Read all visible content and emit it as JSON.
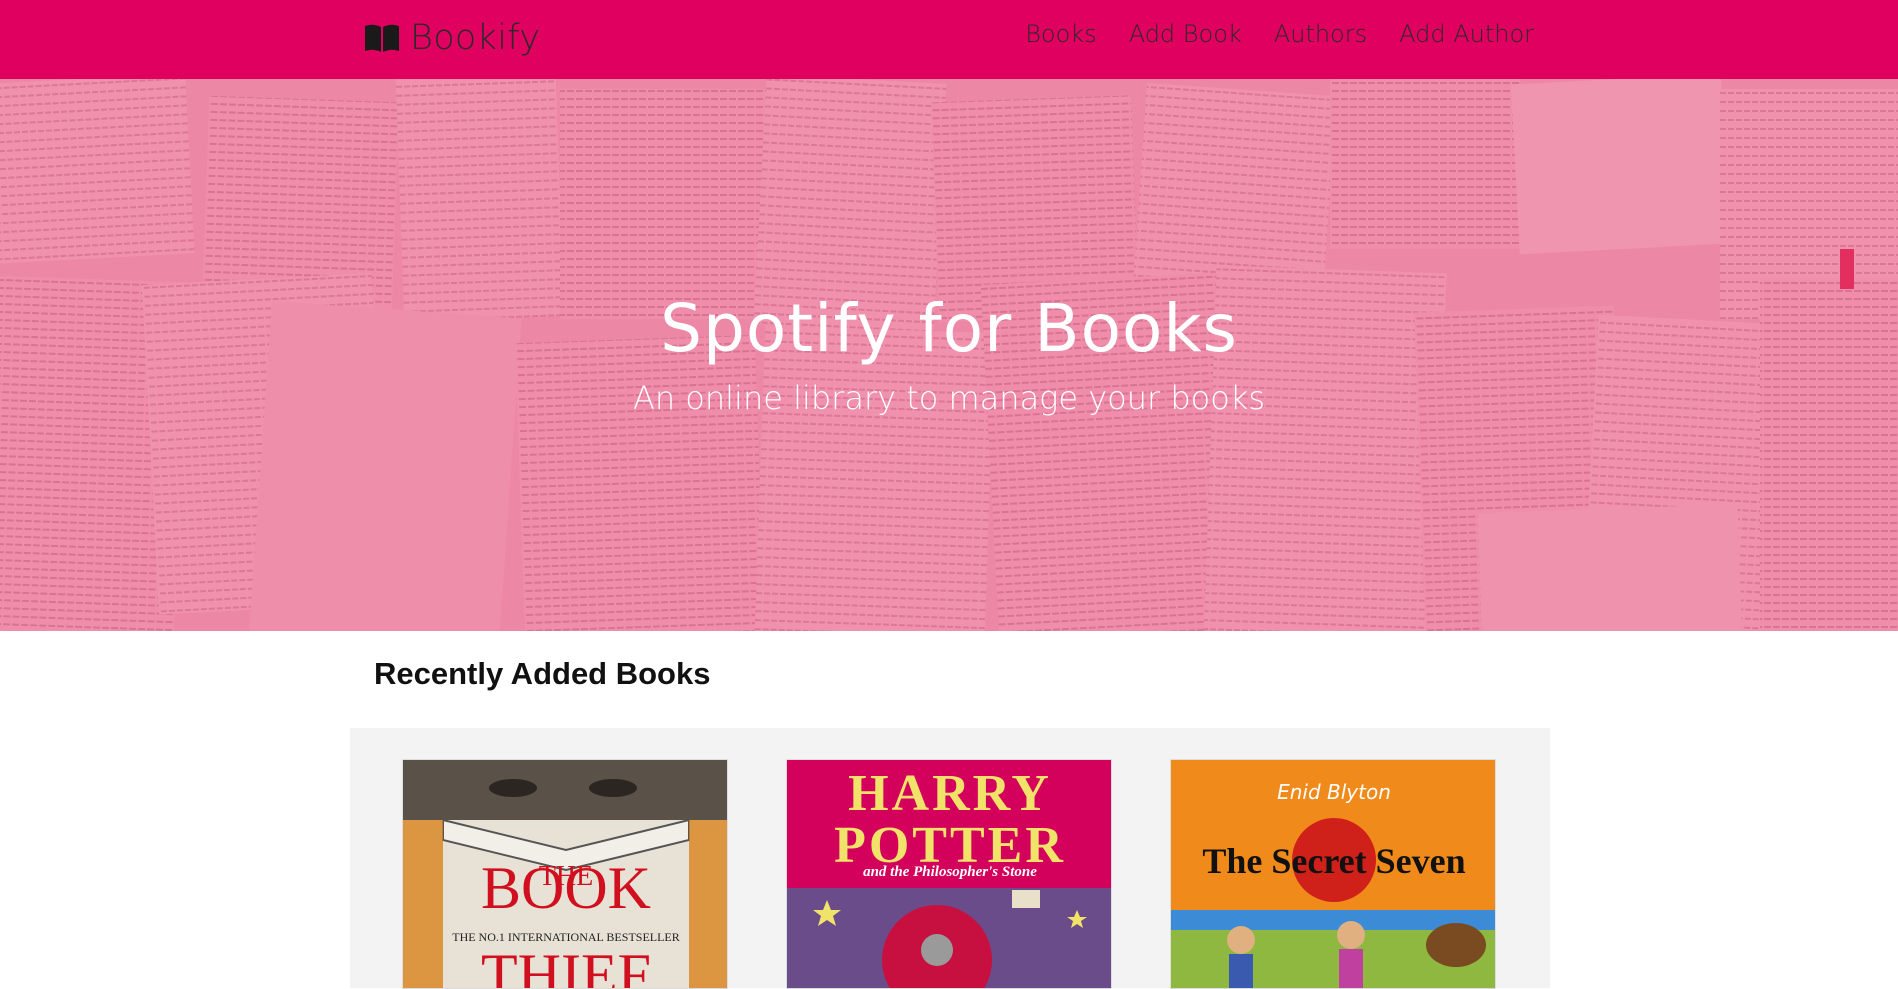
{
  "navbar": {
    "brand": "Bookify",
    "brand_icon": "open-book-icon",
    "links": [
      "Books",
      "Add Book",
      "Authors",
      "Add Author"
    ]
  },
  "hero": {
    "title": "Spotify for Books",
    "subtitle": "An online library to manage your books"
  },
  "recent": {
    "heading": "Recently Added Books",
    "books": [
      {
        "cover_top": "THE NO.1 INTERNATIONAL BESTSELLER",
        "cover_title": "THE BOOK THIEF"
      },
      {
        "cover_title": "HARRY POTTER",
        "cover_sub": "and the Philosopher's Stone"
      },
      {
        "cover_author": "Enid Blyton",
        "cover_title": "The Secret Seven"
      }
    ]
  },
  "colors": {
    "accent": "#e0005f",
    "hero_tint": "#e62864"
  }
}
